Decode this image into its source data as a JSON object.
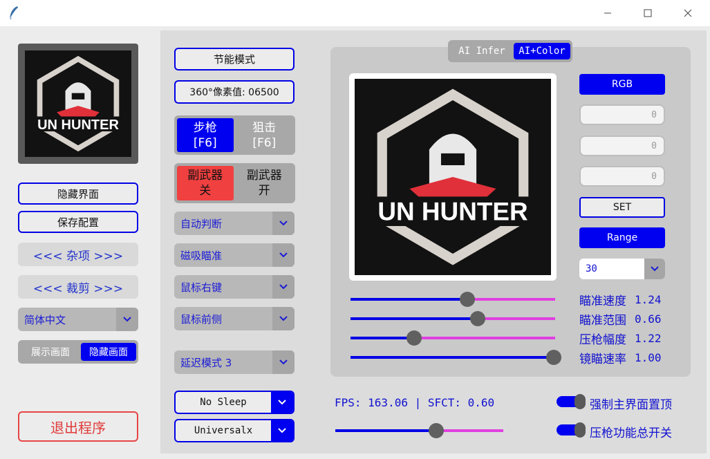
{
  "logo": {
    "text": "UN HUNTER"
  },
  "left": {
    "hide_ui": "隐藏界面",
    "save_config": "保存配置",
    "misc": "<<< 杂项 >>>",
    "crop": "<<< 裁剪 >>>",
    "language": "简体中文",
    "show_screen": "展示画面",
    "hide_screen": "隐藏画面",
    "exit": "退出程序"
  },
  "middle": {
    "power_mode": "节能模式",
    "pixel_value": "360°像素值: 06500",
    "rifle_label": "步枪",
    "rifle_key": "[F6]",
    "sniper_label": "狙击",
    "sniper_key": "[F6]",
    "secondary_off_label": "副武器",
    "secondary_off_state": "关",
    "secondary_on_label": "副武器",
    "secondary_on_state": "开",
    "dropdowns": [
      "自动判断",
      "磁吸瞄准",
      "鼠标右键",
      "鼠标前侧"
    ],
    "delay_mode": "延迟模式 3",
    "sleep_mode": "No Sleep",
    "mouse_driver": "Universalx"
  },
  "preview": {
    "tab_infer": "AI Infer",
    "tab_color": "AI+Color",
    "rgb_button": "RGB",
    "rgb_values": [
      "0",
      "0",
      "0"
    ],
    "set_button": "SET",
    "range_button": "Range",
    "range_value": "30"
  },
  "sliders": [
    {
      "label": "瞄准速度",
      "value": "1.24",
      "fraction": 0.57
    },
    {
      "label": "瞄准范围",
      "value": "0.66",
      "fraction": 0.62
    },
    {
      "label": "压枪幅度",
      "value": "1.22",
      "fraction": 0.31
    },
    {
      "label": "镜瞄速率",
      "value": "1.00",
      "fraction": 1.0
    }
  ],
  "status": {
    "fps_text": "FPS: 163.06 | SFCT: 0.60",
    "bottom_slider_fraction": 0.6
  },
  "toggles": {
    "topmost": "强制主界面置顶",
    "recoil_master": "压枪功能总开关"
  },
  "colors": {
    "accent_blue": "#0000f0",
    "slider_pink": "#e040e0",
    "alert_red": "#f04040"
  }
}
